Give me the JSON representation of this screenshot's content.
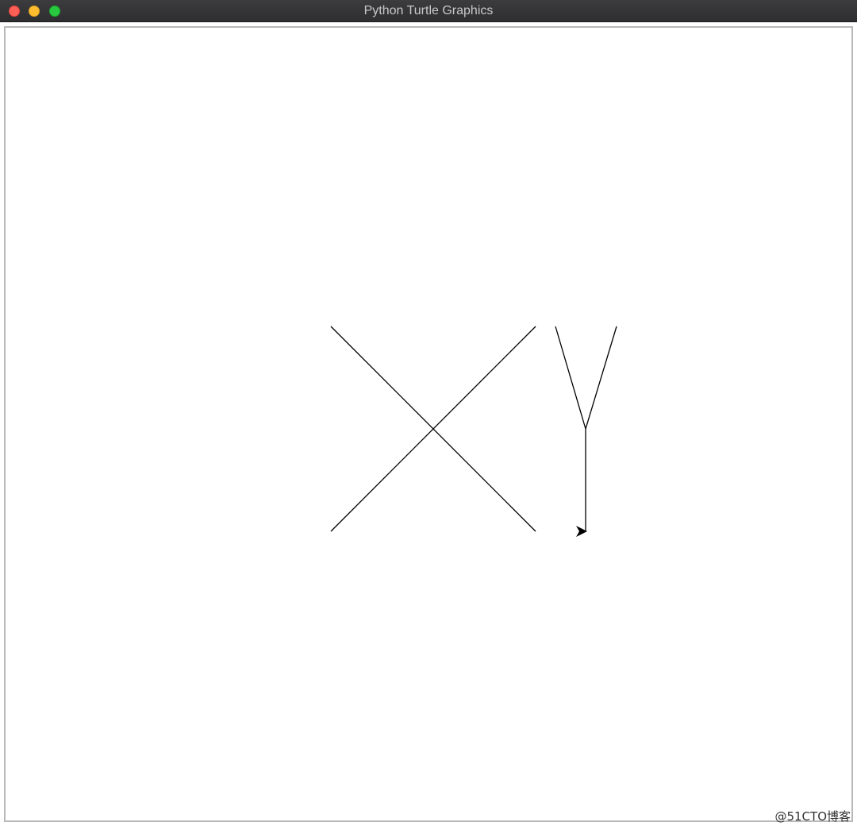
{
  "window": {
    "title": "Python Turtle Graphics"
  },
  "traffic_lights": {
    "close_color": "#fe5f57",
    "minimize_color": "#febc2e",
    "maximize_color": "#28c840"
  },
  "canvas": {
    "background": "#ffffff",
    "pen_color": "#000000",
    "drawing": {
      "letters": [
        "X",
        "Y"
      ],
      "turtle_heading": "right"
    }
  },
  "watermark": {
    "text": "@51CTO博客"
  }
}
